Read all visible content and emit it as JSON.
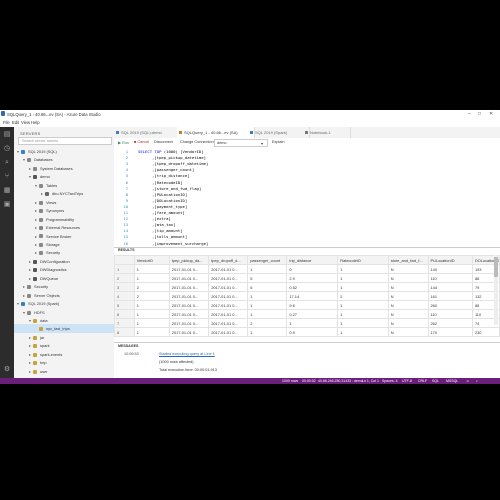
{
  "window": {
    "title": "SQLQuery_1 - 40.66...ev (SA) - Azure Data Studio",
    "min": "–",
    "max": "□",
    "close": "✕"
  },
  "menu": [
    "File",
    "Edit",
    "View",
    "Help"
  ],
  "sidebar": {
    "header": "SERVERS",
    "search_placeholder": "Search server names",
    "items": [
      {
        "label": "SQL 2019 (SQL)",
        "depth": 0,
        "chev": "▾",
        "color": "#3b7dc4"
      },
      {
        "label": "Databases",
        "depth": 1,
        "chev": "▾",
        "color": "#888"
      },
      {
        "label": "System Databases",
        "depth": 2,
        "chev": "▸",
        "color": "#888"
      },
      {
        "label": "demo",
        "depth": 2,
        "chev": "▾",
        "color": "#555"
      },
      {
        "label": "Tables",
        "depth": 3,
        "chev": "▾",
        "color": "#888"
      },
      {
        "label": "dbo.NYCTaxiTrips",
        "depth": 4,
        "chev": "▸",
        "color": "#666"
      },
      {
        "label": "Views",
        "depth": 3,
        "chev": "▸",
        "color": "#888"
      },
      {
        "label": "Synonyms",
        "depth": 3,
        "chev": "▸",
        "color": "#888"
      },
      {
        "label": "Programmability",
        "depth": 3,
        "chev": "▸",
        "color": "#888"
      },
      {
        "label": "External Resources",
        "depth": 3,
        "chev": "▸",
        "color": "#888"
      },
      {
        "label": "Service Broker",
        "depth": 3,
        "chev": "▸",
        "color": "#888"
      },
      {
        "label": "Storage",
        "depth": 3,
        "chev": "▸",
        "color": "#888"
      },
      {
        "label": "Security",
        "depth": 3,
        "chev": "▸",
        "color": "#888"
      },
      {
        "label": "DWConfiguration",
        "depth": 2,
        "chev": "▸",
        "color": "#555"
      },
      {
        "label": "DWDiagnostics",
        "depth": 2,
        "chev": "▸",
        "color": "#555"
      },
      {
        "label": "DWQueue",
        "depth": 2,
        "chev": "▸",
        "color": "#555"
      },
      {
        "label": "Security",
        "depth": 1,
        "chev": "▸",
        "color": "#888"
      },
      {
        "label": "Server Objects",
        "depth": 1,
        "chev": "▸",
        "color": "#888"
      },
      {
        "label": "SQL 2019 (Spark)",
        "depth": 0,
        "chev": "▾",
        "color": "#3b7dc4"
      },
      {
        "label": "HDFS",
        "depth": 1,
        "chev": "▾",
        "color": "#888"
      },
      {
        "label": "data",
        "depth": 2,
        "chev": "▾",
        "color": "#c8a23c"
      },
      {
        "label": "nyc_taxi_trips",
        "depth": 3,
        "chev": "",
        "color": "#c8a23c",
        "selected": true
      },
      {
        "label": "jar",
        "depth": 2,
        "chev": "▸",
        "color": "#c8a23c"
      },
      {
        "label": "spark",
        "depth": 2,
        "chev": "▸",
        "color": "#c8a23c"
      },
      {
        "label": "spark-events",
        "depth": 2,
        "chev": "▸",
        "color": "#c8a23c"
      },
      {
        "label": "tmp",
        "depth": 2,
        "chev": "▸",
        "color": "#c8a23c"
      },
      {
        "label": "user",
        "depth": 2,
        "chev": "▸",
        "color": "#c8a23c"
      }
    ]
  },
  "tabs": [
    {
      "label": "SQL 2019 (SQL):demo"
    },
    {
      "label": "SQLQuery_1 - 40.66...ev (SA)",
      "active": true
    },
    {
      "label": "SQL 2019 (Spark)"
    },
    {
      "label": "Notebook-1"
    }
  ],
  "toolbar": {
    "run": "▶ Run",
    "cancel": "■ Cancel",
    "disconnect": "Disconnect",
    "change_connection": "Change Connection",
    "database": "demo",
    "explain": "Explain"
  },
  "editor": {
    "lines": [
      "SELECT TOP (1000) [VendorID]",
      "      ,[tpep_pickup_datetime]",
      "      ,[tpep_dropoff_datetime]",
      "      ,[passenger_count]",
      "      ,[trip_distance]",
      "      ,[RatecodeID]",
      "      ,[store_and_fwd_flag]",
      "      ,[PULocationID]",
      "      ,[DOLocationID]",
      "      ,[payment_type]",
      "      ,[fare_amount]",
      "      ,[extra]",
      "      ,[mta_tax]",
      "      ,[tip_amount]",
      "      ,[tolls_amount]",
      "      ,[improvement_surcharge]"
    ]
  },
  "results": {
    "header": "RESULTS",
    "columns": [
      "",
      "VendorID",
      "tpep_pickup_da...",
      "tpep_dropoff_d...",
      "passenger_count",
      "trip_distance",
      "RatecodeID",
      "store_and_fwd_f...",
      "PULocationID",
      "DOLocationID"
    ],
    "rows": [
      [
        "1",
        "1",
        "2017-01-01 0...",
        "2017-01-01 0...",
        "1",
        "0",
        "1",
        "N",
        "140",
        "193"
      ],
      [
        "2",
        "1",
        "2017-01-01 0...",
        "2017-01-01 0...",
        "5",
        "2.9",
        "1",
        "N",
        "110",
        "88"
      ],
      [
        "3",
        "2",
        "2017-01-01 0...",
        "2017-01-01 0...",
        "6",
        "0.52",
        "1",
        "N",
        "144",
        "79"
      ],
      [
        "4",
        "2",
        "2017-01-01 0...",
        "2017-01-01 0...",
        "1",
        "17.14",
        "2",
        "N",
        "161",
        "132"
      ],
      [
        "5",
        "1",
        "2017-01-01 0...",
        "2017-01-01 0...",
        "1",
        "9.6",
        "1",
        "N",
        "260",
        "88"
      ],
      [
        "6",
        "1",
        "2017-01-01 0...",
        "2017-01-01 0...",
        "1",
        "0.27",
        "1",
        "N",
        "110",
        "110"
      ],
      [
        "7",
        "1",
        "2017-01-01 0...",
        "2017-01-01 0...",
        "2",
        "1",
        "1",
        "N",
        "262",
        "74"
      ],
      [
        "8",
        "1",
        "2017-01-01 0...",
        "2017-01-01 0...",
        "1",
        "0.9",
        "1",
        "N",
        "170",
        "230"
      ]
    ]
  },
  "messages": {
    "header": "MESSAGES",
    "time": "10:06:53",
    "lines": [
      "Started executing query at Line 1",
      "(1000 rows affected)",
      "Total execution time: 00:00:01.913"
    ]
  },
  "status": {
    "rows": "1000 rows",
    "elapsed": "00:00:02",
    "server": "40.68.246.250,31433 : demo",
    "position": "Ln 1, Col 1",
    "spaces": "Spaces: 4",
    "encoding": "UTF-8",
    "eol": "CRLF",
    "lang": "SQL",
    "provider": "MSSQL"
  },
  "colors": {
    "status_bar": "#6a1f7a",
    "activity_bar": "#2c2c2c",
    "keyword": "#0000ff",
    "line_number": "#2b91af"
  }
}
